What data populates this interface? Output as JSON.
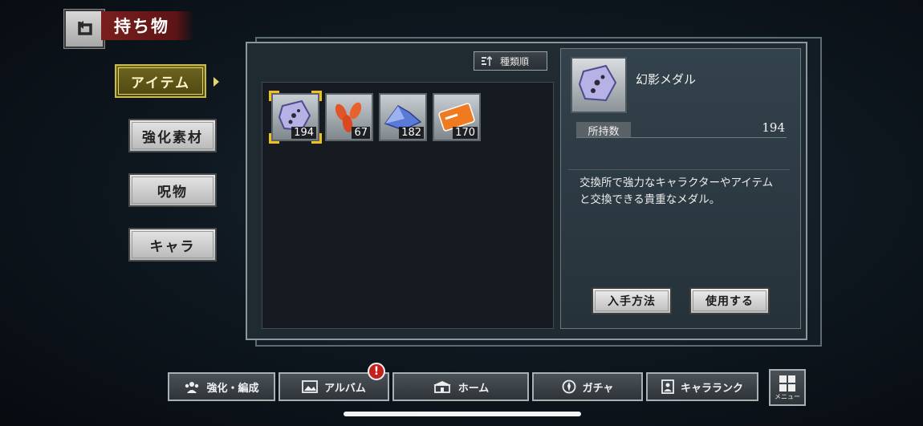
{
  "header": {
    "title": "持ち物"
  },
  "categories": [
    {
      "label": "アイテム",
      "active": true
    },
    {
      "label": "強化素材",
      "active": false
    },
    {
      "label": "呪物",
      "active": false
    },
    {
      "label": "キャラ",
      "active": false
    }
  ],
  "sort": {
    "label": "種類順"
  },
  "items": [
    {
      "icon": "medal-icon",
      "qty": "194",
      "selected": true
    },
    {
      "icon": "leaf-icon",
      "qty": "67",
      "selected": false
    },
    {
      "icon": "crystal-icon",
      "qty": "182",
      "selected": false
    },
    {
      "icon": "ticket-icon",
      "qty": "170",
      "selected": false
    }
  ],
  "detail": {
    "name": "幻影メダル",
    "owned_label": "所持数",
    "owned_value": "194",
    "description_line1": "交換所で強力なキャラクターやアイテム",
    "description_line2": "と交換できる貴重なメダル。",
    "acquire_label": "入手方法",
    "use_label": "使用する"
  },
  "nav": [
    {
      "label": "強化・編成",
      "icon": "party-icon"
    },
    {
      "label": "アルバム",
      "icon": "album-icon",
      "badge": "!"
    },
    {
      "label": "ホーム",
      "icon": "home-icon"
    },
    {
      "label": "ガチャ",
      "icon": "gacha-icon"
    },
    {
      "label": "キャラランク",
      "icon": "character-rank-icon"
    }
  ],
  "menu": {
    "label": "メニュー"
  },
  "colors": {
    "accent_gold": "#f0c020",
    "title_red": "#7a1f1f",
    "badge_red": "#c4201c"
  }
}
